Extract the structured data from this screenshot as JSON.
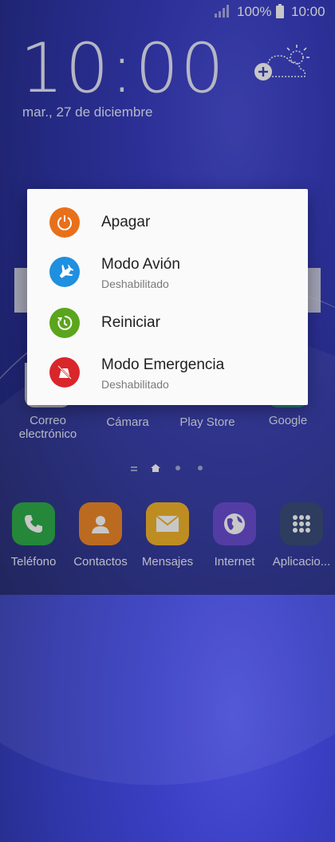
{
  "status_bar": {
    "battery_percent": "100%",
    "time": "10:00"
  },
  "lockscreen": {
    "clock": "10:00",
    "date": "mar., 27 de diciembre"
  },
  "apps": [
    {
      "label_line1": "Correo",
      "label_line2": "electrónico"
    },
    {
      "label_line1": "Cámara",
      "label_line2": ""
    },
    {
      "label_line1": "Play Store",
      "label_line2": ""
    },
    {
      "label_line1": "Google",
      "label_line2": ""
    }
  ],
  "dock": [
    {
      "label": "Teléfono",
      "color": "#2fae4a"
    },
    {
      "label": "Contactos",
      "color": "#f08a2a"
    },
    {
      "label": "Mensajes",
      "color": "#f4b52c"
    },
    {
      "label": "Internet",
      "color": "#6b4fd3"
    },
    {
      "label": "Aplicacio...",
      "color": "#3a4d7a"
    }
  ],
  "power_menu": {
    "items": [
      {
        "label": "Apagar",
        "sub": "",
        "color": "#e8701a",
        "icon": "power-icon"
      },
      {
        "label": "Modo Avión",
        "sub": "Deshabilitado",
        "color": "#1f8fe0",
        "icon": "airplane-icon"
      },
      {
        "label": "Reiniciar",
        "sub": "",
        "color": "#5aa51c",
        "icon": "restart-icon"
      },
      {
        "label": "Modo Emergencia",
        "sub": "Deshabilitado",
        "color": "#d9262b",
        "icon": "emergency-icon"
      }
    ]
  }
}
